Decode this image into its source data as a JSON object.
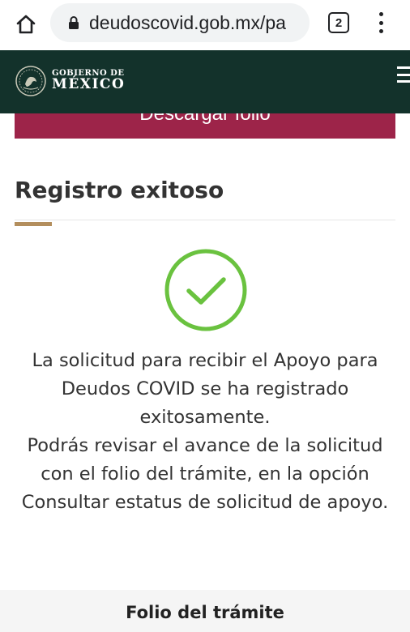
{
  "browser": {
    "url": "deudoscovid.gob.mx/pa",
    "tab_count": "2"
  },
  "header": {
    "logo_line1": "GOBIERNO DE",
    "logo_line2": "MÉXICO"
  },
  "download_button": {
    "label": "Descargar folio"
  },
  "main": {
    "title": "Registro exitoso",
    "message": [
      "La solicitud para recibir el Apoyo para Deudos COVID se ha registrado exitosamente.",
      "Podrás revisar el avance de la solicitud con el folio del trámite, en la opción",
      "Consultar estatus de solicitud de apoyo."
    ],
    "folio_label": "Folio del trámite"
  },
  "colors": {
    "gov_green": "#13322b",
    "guinda": "#9d2449",
    "gold_accent": "#b38e5d",
    "success_green": "#6ac23f"
  }
}
